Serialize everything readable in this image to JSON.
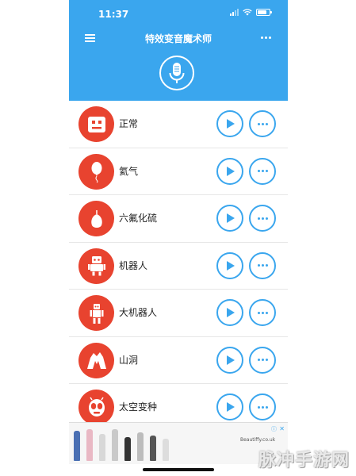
{
  "status_bar": {
    "time": "11:37"
  },
  "header": {
    "title": "特效变音魔术师"
  },
  "colors": {
    "primary": "#3aa6ee",
    "avatar": "#e8432f"
  },
  "voices": [
    {
      "label": "正常",
      "icon": "robot-face-icon"
    },
    {
      "label": "氦气",
      "icon": "balloon-icon"
    },
    {
      "label": "六氟化硫",
      "icon": "gas-bulb-icon"
    },
    {
      "label": "机器人",
      "icon": "robot-icon"
    },
    {
      "label": "大机器人",
      "icon": "big-robot-icon"
    },
    {
      "label": "山洞",
      "icon": "cave-icon"
    },
    {
      "label": "太空变种",
      "icon": "alien-icon"
    }
  ],
  "ad": {
    "brand": "Beautiffy.co.uk",
    "close": "✕",
    "info": "ⓘ"
  },
  "watermark": "脉冲手游网"
}
